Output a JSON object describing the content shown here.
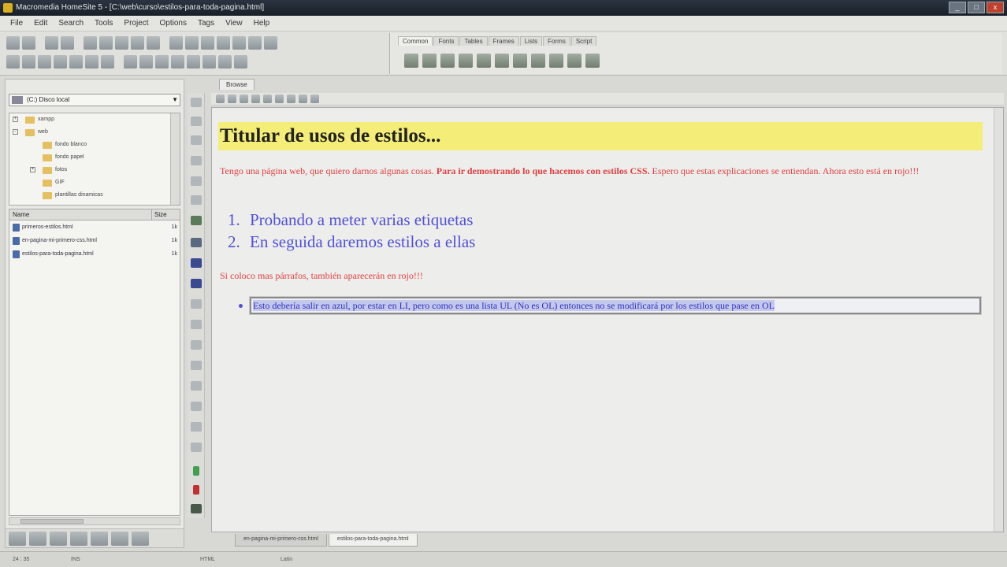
{
  "window": {
    "title": "Macromedia HomeSite 5 - [C:\\web\\curso\\estilos-para-toda-pagina.html]",
    "controls": [
      "_",
      "□",
      "x"
    ]
  },
  "menu": [
    "File",
    "Edit",
    "Search",
    "Tools",
    "Project",
    "Options",
    "Tags",
    "View",
    "Help"
  ],
  "tag_tabs": [
    "Common",
    "Fonts",
    "Tables",
    "Frames",
    "Lists",
    "Forms",
    "Script"
  ],
  "left_panel": {
    "drive": "(C:) Disco local",
    "folders": [
      {
        "label": "xampp",
        "level": 0,
        "expander": "+"
      },
      {
        "label": "web",
        "level": 0,
        "expander": "-"
      },
      {
        "label": "fondo blanco",
        "level": 1,
        "expander": ""
      },
      {
        "label": "fondo papel",
        "level": 1,
        "expander": ""
      },
      {
        "label": "fotos",
        "level": 1,
        "expander": "+"
      },
      {
        "label": "GIF",
        "level": 1,
        "expander": ""
      },
      {
        "label": "plantillas dinamicas",
        "level": 1,
        "expander": ""
      }
    ],
    "file_header": {
      "name": "Name",
      "size": "Size"
    },
    "files": [
      {
        "name": "primeros-estilos.html",
        "size": "1k"
      },
      {
        "name": "en-pagina-mi-primero-css.html",
        "size": "1k"
      },
      {
        "name": "estilos-para-toda-pagina.html",
        "size": "1k"
      }
    ]
  },
  "editor": {
    "tab_label": "Browse",
    "title": "Titular de usos de estilos...",
    "p1_normal": "Tengo una página web, que quiero darnos algunas cosas. ",
    "p1_bold": "Para ir demostrando lo que hacemos con estilos CSS.",
    "p1_rest": " Espero que estas explicaciones se entiendan. Ahora esto está en rojo!!!",
    "list": [
      {
        "num": "1.",
        "text": "Probando a meter varias etiquetas"
      },
      {
        "num": "2.",
        "text": "En seguida daremos estilos a ellas"
      }
    ],
    "p2": "Si coloco mas párrafos, también aparecerán en rojo!!!",
    "ul_item": "Esto debería salir en azul, por estar en LI, pero como es una lista UL (No es OL) entonces no se modificará por los estilos que pase en OL"
  },
  "doc_tabs": [
    "en-pagina-mi-primero-css.html",
    "estilos-para-toda-pagina.html"
  ],
  "status": {
    "pos": "24 : 35",
    "ins": "INS",
    "mode": "HTML",
    "encoding": "Latin"
  },
  "colors": {
    "title_bg": "#f4ee78",
    "red_text": "#e04040",
    "blue_text": "#5050d8"
  }
}
